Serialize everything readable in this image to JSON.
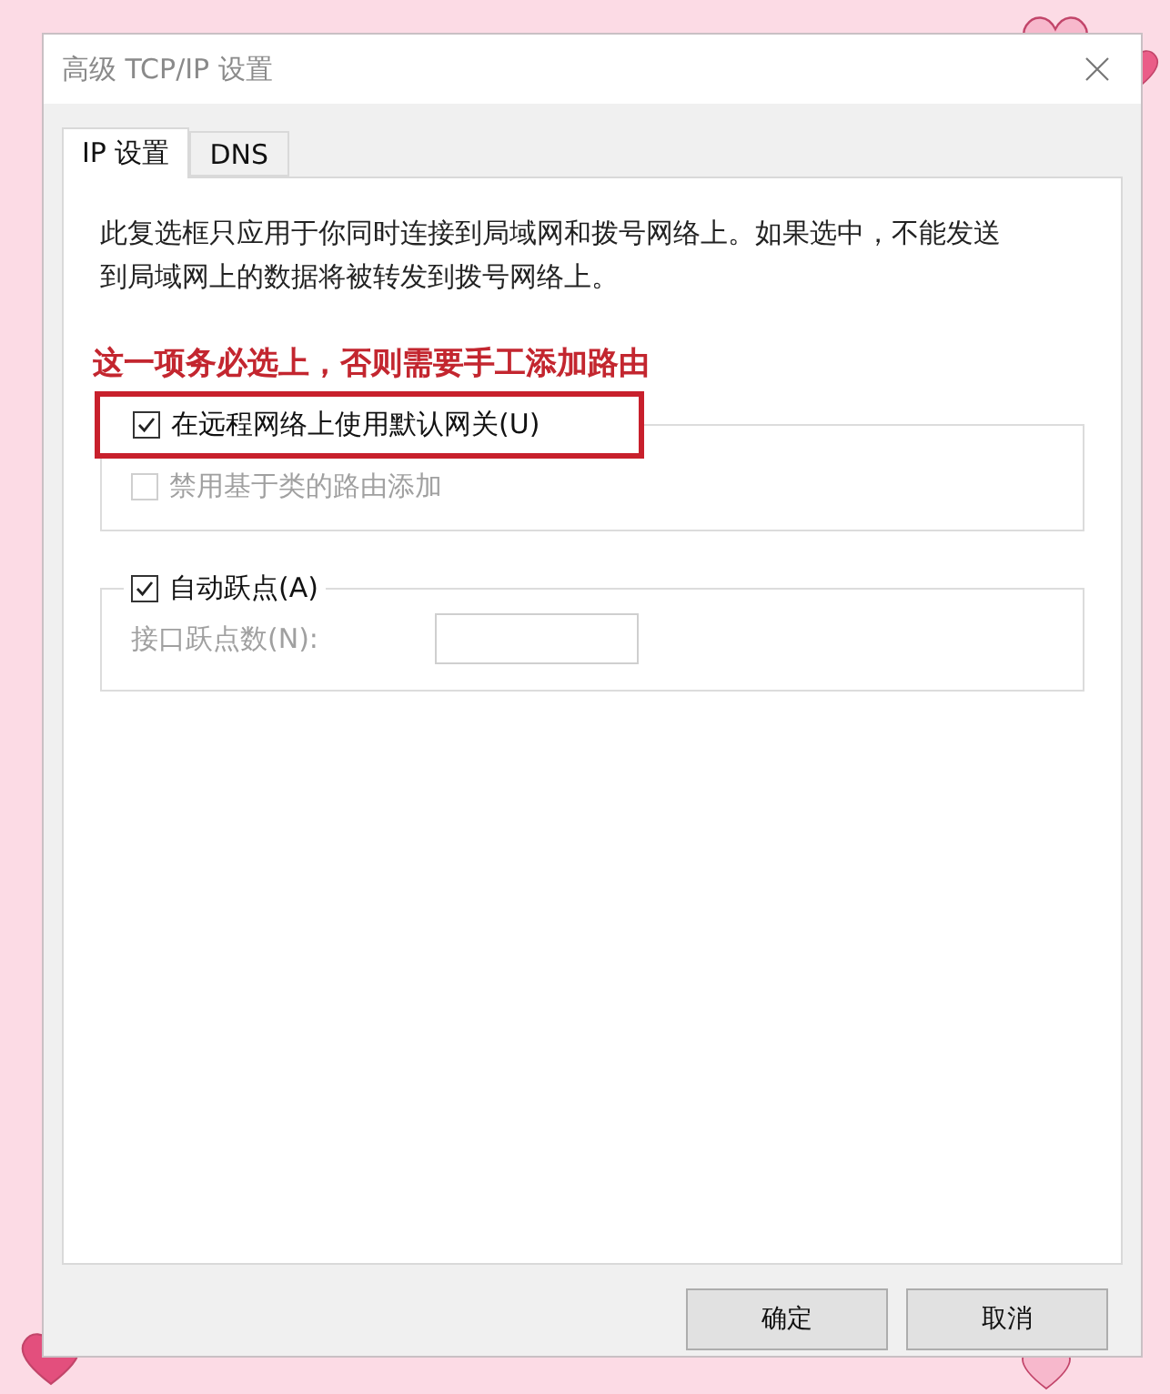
{
  "window": {
    "title": "高级 TCP/IP 设置"
  },
  "tabs": [
    {
      "label": "IP 设置",
      "selected": true
    },
    {
      "label": "DNS",
      "selected": false
    }
  ],
  "description": "此复选框只应用于你同时连接到局域网和拨号网络上。如果选中，不能发送到局域网上的数据将被转发到拨号网络上。",
  "annotation": "这一项务必选上，否则需要手工添加路由",
  "gateway_group": {
    "option": {
      "label": "在远程网络上使用默认网关(U)",
      "checked": true,
      "highlighted": true
    },
    "sub_option": {
      "label": "禁用基于类的路由添加",
      "checked": false,
      "disabled": true
    }
  },
  "metric_group": {
    "option": {
      "label": "自动跃点(A)",
      "checked": true
    },
    "field": {
      "label": "接口跃点数(N):",
      "disabled": true
    }
  },
  "buttons": [
    "确定",
    "取消"
  ]
}
